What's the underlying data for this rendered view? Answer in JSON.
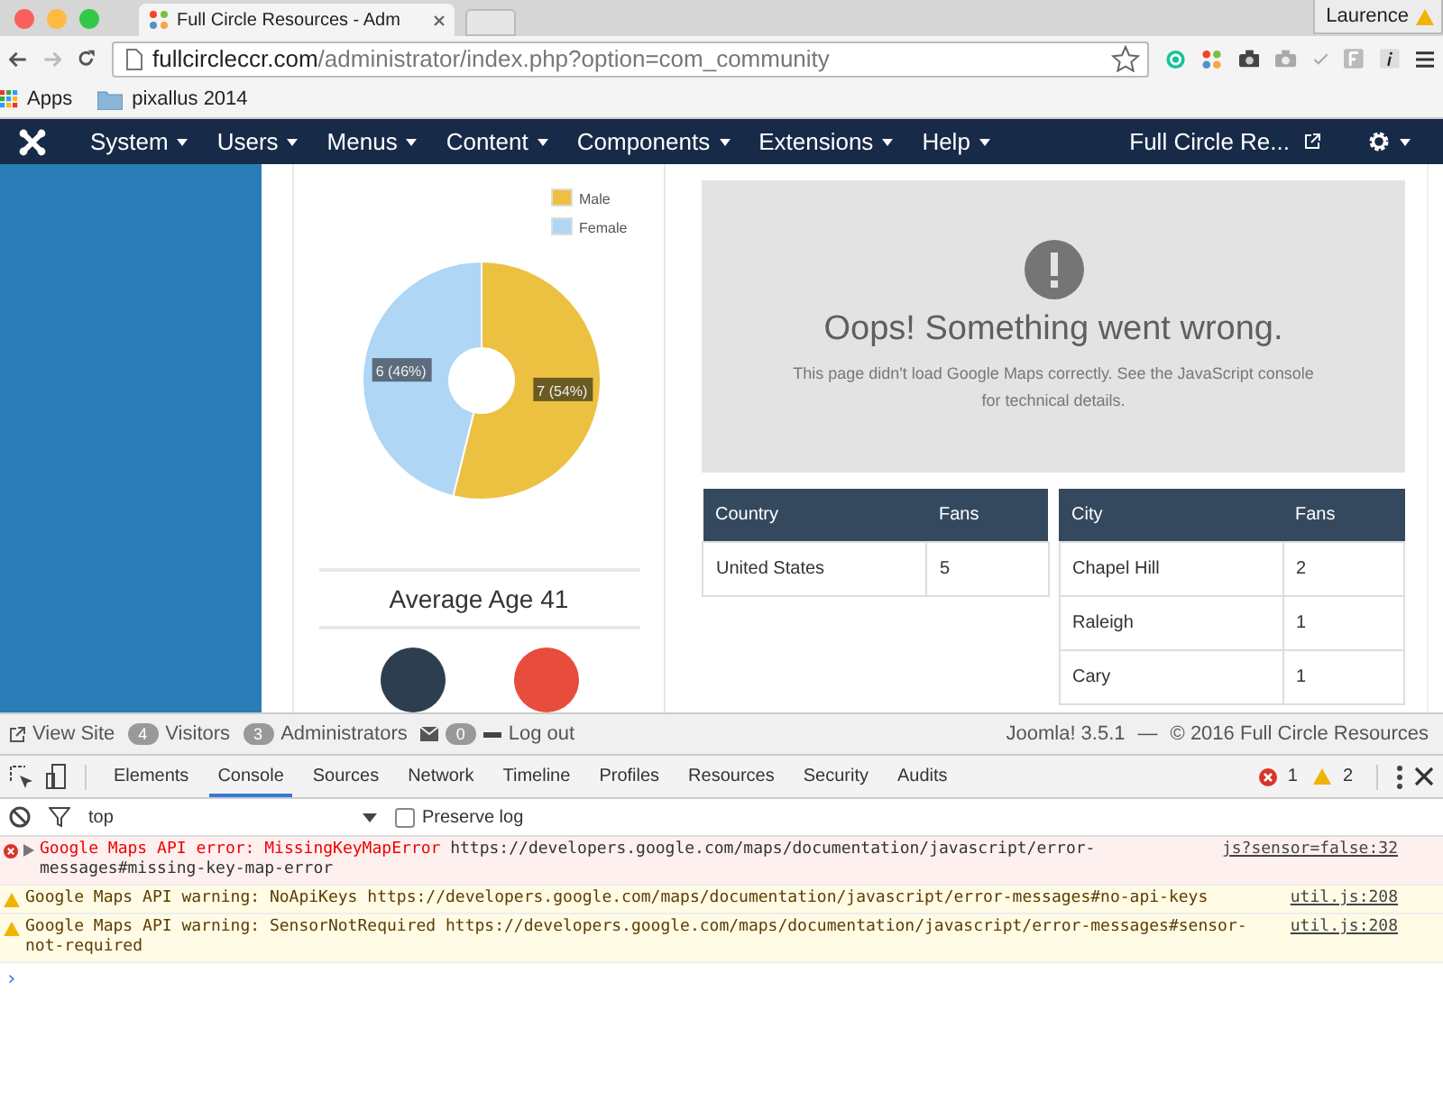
{
  "browser": {
    "tab_title": "Full Circle Resources - Adm",
    "profile": "Laurence",
    "url_host": "fullcircleccr.com",
    "url_path": "/administrator/index.php?option=com_community",
    "bookmarks": [
      {
        "kind": "apps",
        "label": "Apps"
      },
      {
        "kind": "folder",
        "label": "pixallus 2014"
      }
    ]
  },
  "nav": {
    "menus": [
      "System",
      "Users",
      "Menus",
      "Content",
      "Components",
      "Extensions",
      "Help"
    ],
    "site_link": "Full Circle Re..."
  },
  "gender_chart": {
    "chart_data": {
      "type": "donut",
      "categories": [
        "Male",
        "Female"
      ],
      "values": [
        7,
        6
      ],
      "colors": [
        "#ecc041",
        "#afd6f5"
      ],
      "data_labels": "value_labels",
      "value_labels": [
        "7 (54%)",
        "6 (46%)"
      ],
      "legend": "top-right"
    }
  },
  "average_age": "Average Age 41",
  "map_error": {
    "title": "Oops! Something went wrong.",
    "message": "This page didn't load Google Maps correctly. See the JavaScript console for technical details."
  },
  "country_table": {
    "columns": [
      "Country",
      "Fans"
    ],
    "rows": [
      [
        "United States",
        "5"
      ]
    ]
  },
  "city_table": {
    "columns": [
      "City",
      "Fans"
    ],
    "rows": [
      [
        "Chapel Hill",
        "2"
      ],
      [
        "Raleigh",
        "1"
      ],
      [
        "Cary",
        "1"
      ]
    ]
  },
  "status_bar": {
    "view_site": "View Site",
    "visitors_count": "4",
    "visitors": "Visitors",
    "admins_count": "3",
    "admins": "Administrators",
    "messages_count": "0",
    "logout": "Log out",
    "version": "Joomla! 3.5.1",
    "separator": "—",
    "copyright": "© 2016 Full Circle Resources"
  },
  "devtools": {
    "tabs": [
      {
        "label": "Elements",
        "selected": false
      },
      {
        "label": "Console",
        "selected": true
      },
      {
        "label": "Sources",
        "selected": false
      },
      {
        "label": "Network",
        "selected": false
      },
      {
        "label": "Timeline",
        "selected": false
      },
      {
        "label": "Profiles",
        "selected": false
      },
      {
        "label": "Resources",
        "selected": false
      },
      {
        "label": "Security",
        "selected": false
      },
      {
        "label": "Audits",
        "selected": false
      }
    ],
    "error_count": "1",
    "warning_count": "2",
    "context": "top",
    "preserve_log": {
      "label": "Preserve log",
      "checked": false
    },
    "messages": [
      {
        "kind": "error",
        "message": "Google Maps API error: MissingKeyMapError",
        "url": "https://developers.google.com/maps/documentation/javascript/error-messages#missing-key-map-error",
        "source": "js?sensor=false:32"
      },
      {
        "kind": "warning",
        "message": "Google Maps API warning: NoApiKeys",
        "url": "https://developers.google.com/maps/documentation/javascript/error-messages#no-api-keys",
        "source": "util.js:208"
      },
      {
        "kind": "warning",
        "message": "Google Maps API warning: SensorNotRequired",
        "url": "https://developers.google.com/maps/documentation/javascript/error-messages#sensor-not-required",
        "source": "util.js:208"
      }
    ],
    "prompt": "›"
  }
}
